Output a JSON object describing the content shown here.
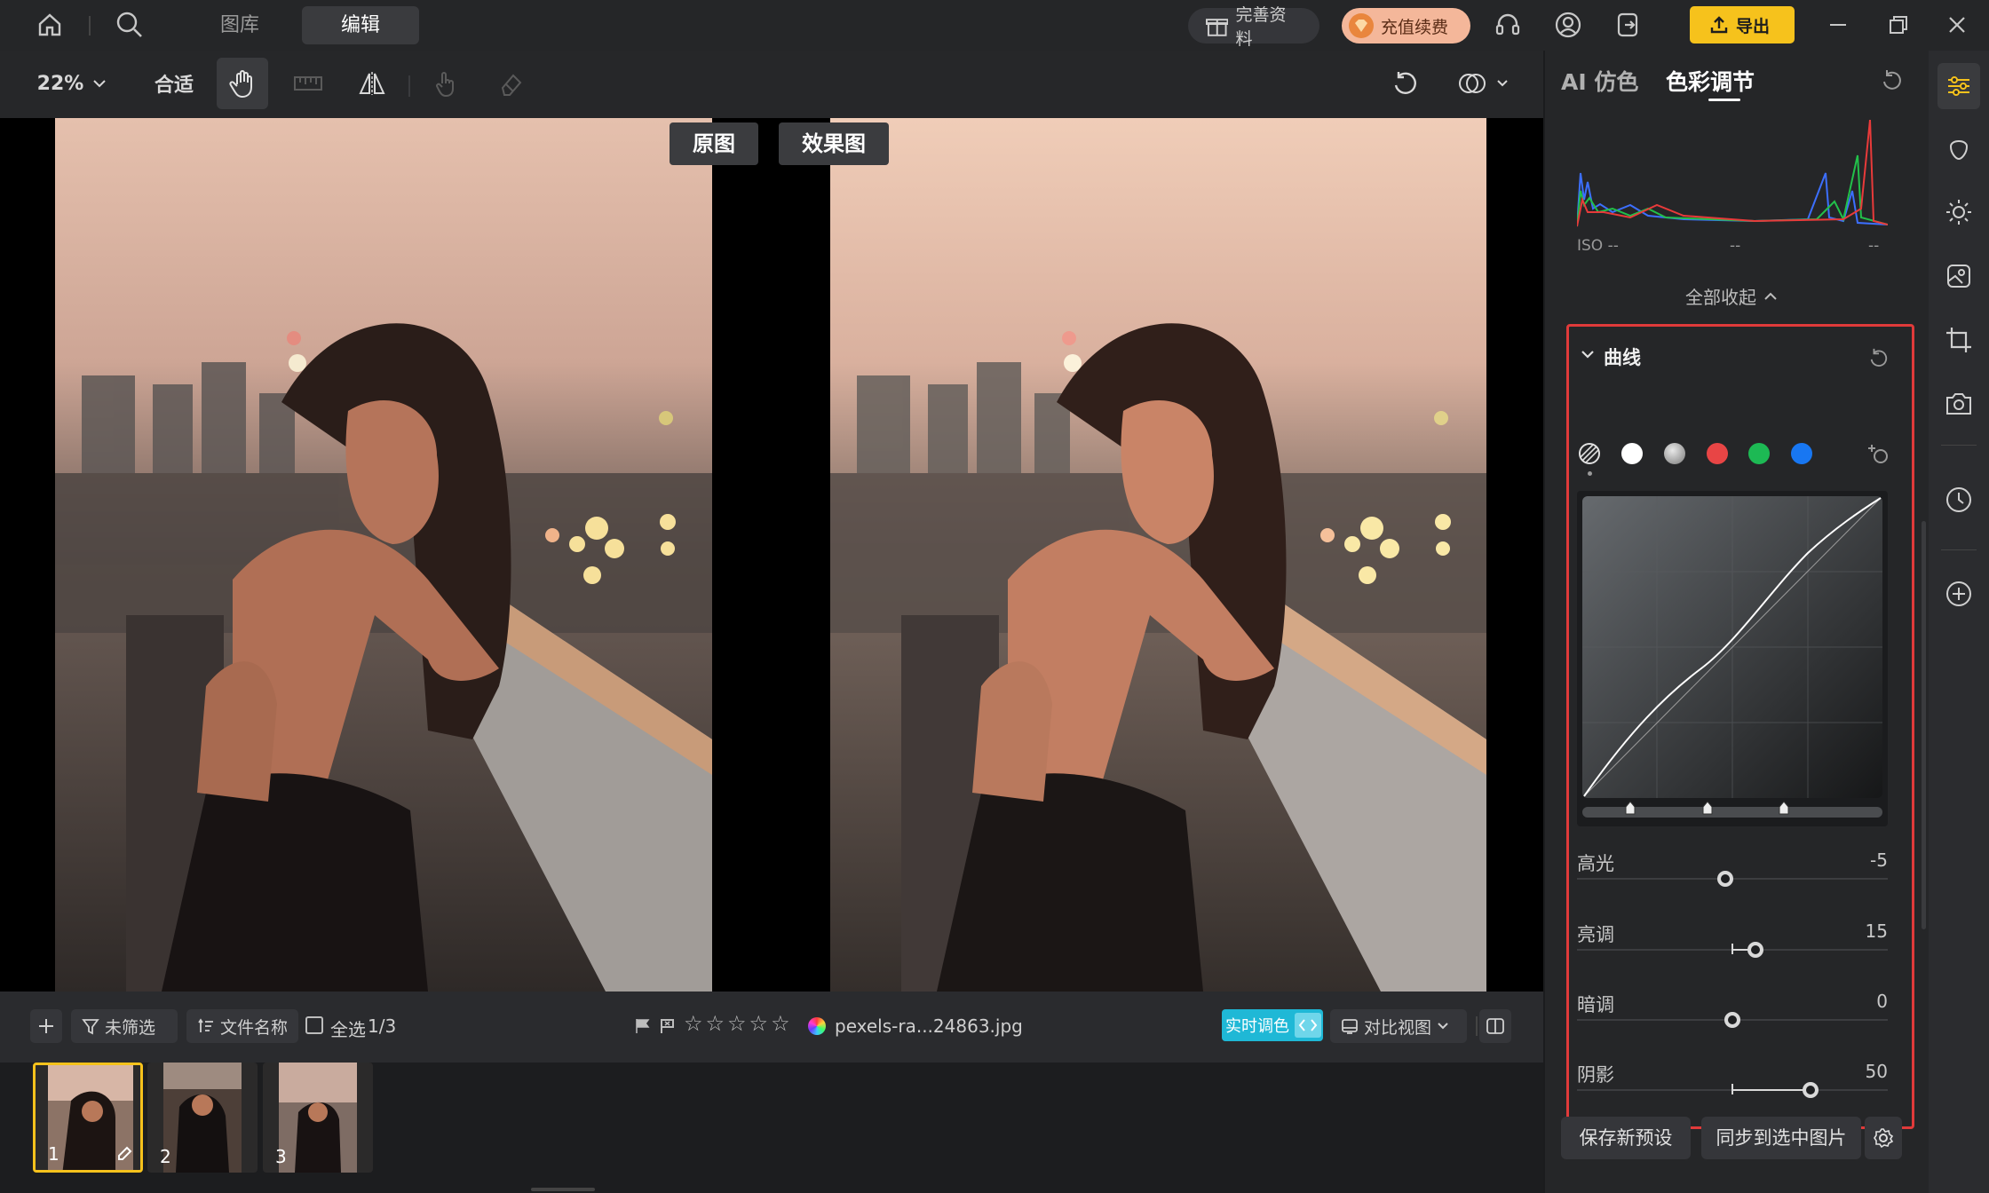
{
  "topbar": {
    "tab_gallery": "图库",
    "tab_edit": "编辑",
    "complete_profile": "完善资料",
    "recharge": "充值续费",
    "export": "导出"
  },
  "toolbar": {
    "zoom": "22%",
    "fit": "合适"
  },
  "compare": {
    "original": "原图",
    "result": "效果图"
  },
  "bottombar": {
    "filter": "未筛选",
    "sort": "文件名称",
    "select_all": "全选",
    "count": "1/3",
    "filename": "pexels-ra...24863.jpg",
    "realtime": "实时调色",
    "compare_view": "对比视图"
  },
  "filmstrip": {
    "items": [
      {
        "num": "1",
        "selected": true
      },
      {
        "num": "2",
        "selected": false
      },
      {
        "num": "3",
        "selected": false
      }
    ]
  },
  "panel": {
    "tab_ai": "AI 仿色",
    "tab_color": "色彩调节",
    "iso": "ISO --",
    "dash1": "--",
    "dash2": "--",
    "collapse_all": "全部收起",
    "curve_title": "曲线",
    "sliders": [
      {
        "label": "高光",
        "value": "-5"
      },
      {
        "label": "亮调",
        "value": "15"
      },
      {
        "label": "暗调",
        "value": "0"
      },
      {
        "label": "阴影",
        "value": "50"
      }
    ],
    "save_preset": "保存新预设",
    "sync": "同步到选中图片"
  },
  "colors": {
    "accent_yellow": "#f6c21c",
    "realtime_cyan": "#1fb8d6",
    "highlight_red": "#e03a3a",
    "red": "#e84545",
    "green": "#1db954",
    "blue": "#1877f2"
  }
}
